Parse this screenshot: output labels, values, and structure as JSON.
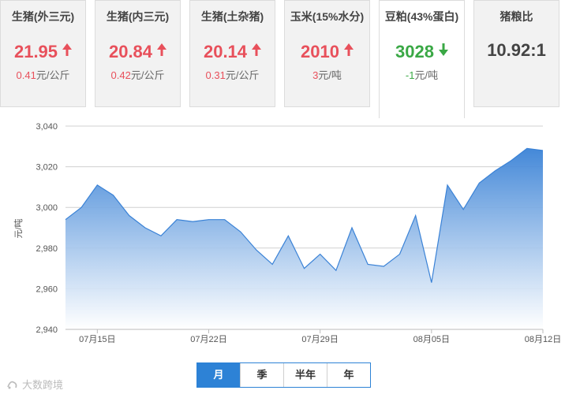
{
  "cards": [
    {
      "title": "生猪(外三元)",
      "price": "21.95",
      "trend": "up",
      "change": "0.41",
      "unit": "元/公斤"
    },
    {
      "title": "生猪(内三元)",
      "price": "20.84",
      "trend": "up",
      "change": "0.42",
      "unit": "元/公斤"
    },
    {
      "title": "生猪(土杂猪)",
      "price": "20.14",
      "trend": "up",
      "change": "0.31",
      "unit": "元/公斤"
    },
    {
      "title": "玉米(15%水分)",
      "price": "2010",
      "trend": "up",
      "change": "3",
      "unit": "元/吨"
    },
    {
      "title": "豆粕(43%蛋白)",
      "price": "3028",
      "trend": "down",
      "change": "-1",
      "unit": "元/吨",
      "active": true
    },
    {
      "title": "猪粮比",
      "price": "10.92:1",
      "trend": "none"
    }
  ],
  "chart_data": {
    "type": "area",
    "ylabel": "元/吨",
    "ylim": [
      2940,
      3040
    ],
    "yticks": [
      2940,
      2960,
      2980,
      3000,
      3020,
      3040
    ],
    "ytick_labels": [
      "2,940",
      "2,960",
      "2,980",
      "3,000",
      "3,020",
      "3,040"
    ],
    "xtick_labels": [
      "07月15日",
      "07月22日",
      "07月29日",
      "08月05日",
      "08月12日"
    ],
    "xtick_index": [
      2,
      9,
      16,
      23,
      30
    ],
    "grid": true,
    "series": [
      {
        "values": [
          2994,
          3000,
          3011,
          3006,
          2996,
          2990,
          2986,
          2994,
          2993,
          2994,
          2994,
          2988,
          2979,
          2972,
          2986,
          2970,
          2977,
          2969,
          2990,
          2972,
          2971,
          2977,
          2996,
          2963,
          3011,
          2999,
          3012,
          3018,
          3023,
          3029,
          3028
        ]
      }
    ],
    "line_color": "#3a82d6",
    "fill_top_color": "#3a82d6",
    "fill_bottom_color": "#ffffff"
  },
  "tabs": [
    {
      "label": "月",
      "active": true
    },
    {
      "label": "季",
      "active": false
    },
    {
      "label": "半年",
      "active": false
    },
    {
      "label": "年",
      "active": false
    }
  ],
  "watermark": "大数跨境"
}
